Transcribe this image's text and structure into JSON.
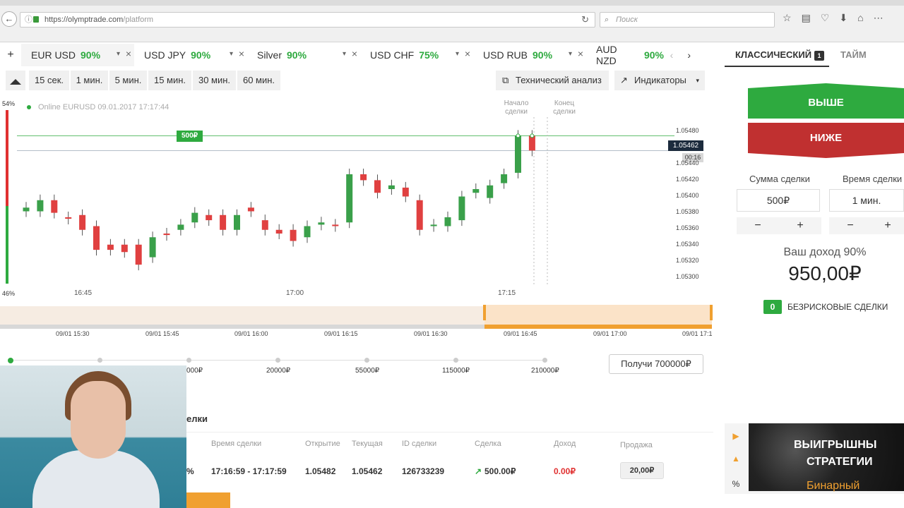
{
  "browser": {
    "url_domain": "https://olymptrade.com",
    "url_path": "/platform",
    "search_placeholder": "Поиск"
  },
  "asset_tabs": [
    {
      "name": "EUR USD",
      "pct": "90%"
    },
    {
      "name": "USD JPY",
      "pct": "90%"
    },
    {
      "name": "Silver",
      "pct": "90%"
    },
    {
      "name": "USD CHF",
      "pct": "75%"
    },
    {
      "name": "USD RUB",
      "pct": "90%"
    },
    {
      "name": "AUD NZD",
      "pct": "90%"
    }
  ],
  "toolbar": {
    "timeframes": [
      "15 сек.",
      "1 мин.",
      "5 мин.",
      "15 мин.",
      "30 мин.",
      "60 мин."
    ],
    "tech_analysis": "Технический анализ",
    "indicators": "Индикаторы"
  },
  "chart": {
    "sentiment_top": "54%",
    "sentiment_bottom": "46%",
    "online": "Online EURUSD 09.01.2017 17:17:44",
    "deal_start": "Начало сделки",
    "deal_end": "Конец сделки",
    "current_price": "1.05462",
    "timer": "00:16",
    "bet_marker": "500₽",
    "y_ticks": [
      "1.05480",
      "1.05460",
      "1.05440",
      "1.05420",
      "1.05400",
      "1.05380",
      "1.05360",
      "1.05340",
      "1.05320",
      "1.05300"
    ],
    "x_ticks": [
      "16:45",
      "17:00",
      "17:15"
    ]
  },
  "chart_data": {
    "type": "candlestick",
    "ylim": [
      1.0529,
      1.0549
    ],
    "candles": [
      {
        "o": 1.0538,
        "c": 1.05385
      },
      {
        "o": 1.0538,
        "c": 1.05395
      },
      {
        "o": 1.05395,
        "c": 1.05378
      },
      {
        "o": 1.05372,
        "c": 1.0537
      },
      {
        "o": 1.05375,
        "c": 1.05355
      },
      {
        "o": 1.0536,
        "c": 1.05328
      },
      {
        "o": 1.05335,
        "c": 1.05328
      },
      {
        "o": 1.05335,
        "c": 1.05325
      },
      {
        "o": 1.05335,
        "c": 1.05308
      },
      {
        "o": 1.05318,
        "c": 1.05345
      },
      {
        "o": 1.0535,
        "c": 1.05348
      },
      {
        "o": 1.05355,
        "c": 1.05362
      },
      {
        "o": 1.05365,
        "c": 1.05378
      },
      {
        "o": 1.05375,
        "c": 1.05368
      },
      {
        "o": 1.05375,
        "c": 1.05355
      },
      {
        "o": 1.05355,
        "c": 1.05375
      },
      {
        "o": 1.05385,
        "c": 1.0538
      },
      {
        "o": 1.05368,
        "c": 1.05355
      },
      {
        "o": 1.05355,
        "c": 1.0535
      },
      {
        "o": 1.05355,
        "c": 1.0534
      },
      {
        "o": 1.05345,
        "c": 1.0536
      },
      {
        "o": 1.05362,
        "c": 1.05365
      },
      {
        "o": 1.05362,
        "c": 1.0536
      },
      {
        "o": 1.05365,
        "c": 1.0543
      },
      {
        "o": 1.0543,
        "c": 1.05422
      },
      {
        "o": 1.05422,
        "c": 1.05405
      },
      {
        "o": 1.0541,
        "c": 1.05415
      },
      {
        "o": 1.05412,
        "c": 1.054
      },
      {
        "o": 1.05395,
        "c": 1.05355
      },
      {
        "o": 1.0536,
        "c": 1.05362
      },
      {
        "o": 1.0536,
        "c": 1.05372
      },
      {
        "o": 1.05368,
        "c": 1.054
      },
      {
        "o": 1.05405,
        "c": 1.0541
      },
      {
        "o": 1.05398,
        "c": 1.05415
      },
      {
        "o": 1.05418,
        "c": 1.0543
      },
      {
        "o": 1.05432,
        "c": 1.05482
      },
      {
        "o": 1.05482,
        "c": 1.05462
      }
    ]
  },
  "navigator": {
    "ticks": [
      "09/01 15:30",
      "09/01 15:45",
      "09/01 16:00",
      "09/01 16:15",
      "09/01 16:30",
      "09/01 16:45",
      "09/01 17:00",
      "09/01 17:1"
    ]
  },
  "progress": {
    "values": [
      "000₽",
      "20000₽",
      "55000₽",
      "115000₽",
      "210000₽"
    ],
    "get_button": "Получи 700000₽"
  },
  "deals": {
    "title": "елки",
    "headers": [
      "Время сделки",
      "Открытие",
      "Текущая",
      "ID сделки",
      "Сделка",
      "Доход",
      "Продажа"
    ],
    "row": {
      "pct": "%",
      "time": "17:16:59 - 17:17:59",
      "open": "1.05482",
      "current": "1.05462",
      "id": "126733239",
      "deal": "500.00₽",
      "income": "0.00₽",
      "sell": "20,00₽"
    }
  },
  "right_panel": {
    "tab_classic": "КЛАССИЧЕСКИЙ",
    "tab_classic_badge": "1",
    "tab_time": "ТАЙМ",
    "btn_up": "ВЫШЕ",
    "btn_down": "НИЖЕ",
    "amount_label": "Сумма сделки",
    "amount_value": "500₽",
    "time_label": "Время сделки",
    "time_value": "1 мин.",
    "minus": "−",
    "plus": "+",
    "income_label": "Ваш доход 90%",
    "income_value": "950,00₽",
    "riskfree_count": "0",
    "riskfree_label": "БЕЗРИСКОВЫЕ СДЕЛКИ"
  },
  "promo": {
    "line1": "ВЫИГРЫШНЫ",
    "line2": "СТРАТЕГИИ",
    "line3": "Бинарный"
  },
  "colors": {
    "green": "#2eaa3f",
    "red": "#e03030",
    "orange": "#f0a030"
  }
}
